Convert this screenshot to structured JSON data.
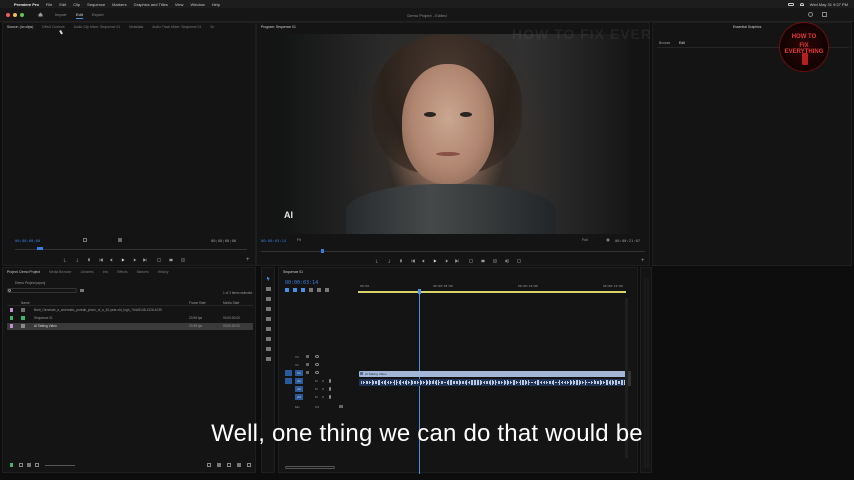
{
  "menubar": {
    "app_name": "Premiere Pro",
    "items": [
      "File",
      "Edit",
      "Clip",
      "Sequence",
      "Markers",
      "Graphics and Titles",
      "View",
      "Window",
      "Help"
    ],
    "clock": "Wed May 31  9:27 PM"
  },
  "header": {
    "workspaces": [
      "Import",
      "Edit",
      "Export"
    ],
    "active_workspace": "Edit",
    "document_title": "Demo Project - Edited"
  },
  "source_panel": {
    "tabs": [
      "Source: (no clips)",
      "Effect Controls",
      "Audio Clip Mixer: Sequence 01",
      "Metadata",
      "Audio Track Mixer: Sequence 01",
      "Sc"
    ],
    "timecode_left": "00;00;00;00",
    "timecode_right": "00;00;00;00"
  },
  "program_panel": {
    "tab": "Program: Sequence 01",
    "timecode_left": "00:00:03:14",
    "zoom": "Fit",
    "quality": "Full",
    "duration": "00:00:21:07",
    "badge": "AI"
  },
  "right_panel": {
    "tabs": [
      "Essential Graphics"
    ],
    "subtabs": [
      "Browse",
      "Edit"
    ]
  },
  "watermark": {
    "ghost_text": "HOW TO FIX EVERYTHING",
    "logo_line1": "HOW TO",
    "logo_line2": "FIX EVERYTHING"
  },
  "project_panel": {
    "tabs": [
      "Project: Demo Project",
      "Media Browser",
      "Libraries",
      "Info",
      "Effects",
      "Markers",
      "History"
    ],
    "path": "Demo Project.prproj",
    "item_count": "1 of 3 items selected",
    "columns": [
      "Name",
      "Frame Rate",
      "Media Start"
    ],
    "rows": [
      {
        "name": "Bartl_Generate_a_cinematic_portrait_photo_of_a_40-year-old_high_7d4d3148-1326-4039",
        "frame_rate": "",
        "media_start": "",
        "color": "#c48fd6"
      },
      {
        "name": "Sequence 01",
        "frame_rate": "23.98 fps",
        "media_start": "00:00:00:00",
        "color": "#3db56a"
      },
      {
        "name": "AI Talking Video",
        "frame_rate": "23.98 fps",
        "media_start": "00:00:00:00",
        "color": "#c48fd6"
      }
    ]
  },
  "timeline": {
    "tab": "Sequence 01",
    "timecode": "00:00:03:14",
    "ruler": [
      "00:00",
      "00:00:05:00",
      "00:00:10:00",
      "00:00:15:00"
    ],
    "video_tracks": [
      "V3",
      "V2",
      "V1"
    ],
    "audio_tracks": [
      "A1",
      "A2",
      "A3"
    ],
    "mix_label": "Mix",
    "mix_value": "0.0",
    "clip_label": "AI Talking Video"
  },
  "subtitle": "Well, one thing we can do that would be",
  "colors": {
    "accent": "#3a7de0",
    "clip_video": "#a3b6d8",
    "playhead": "#4b8fe2"
  }
}
